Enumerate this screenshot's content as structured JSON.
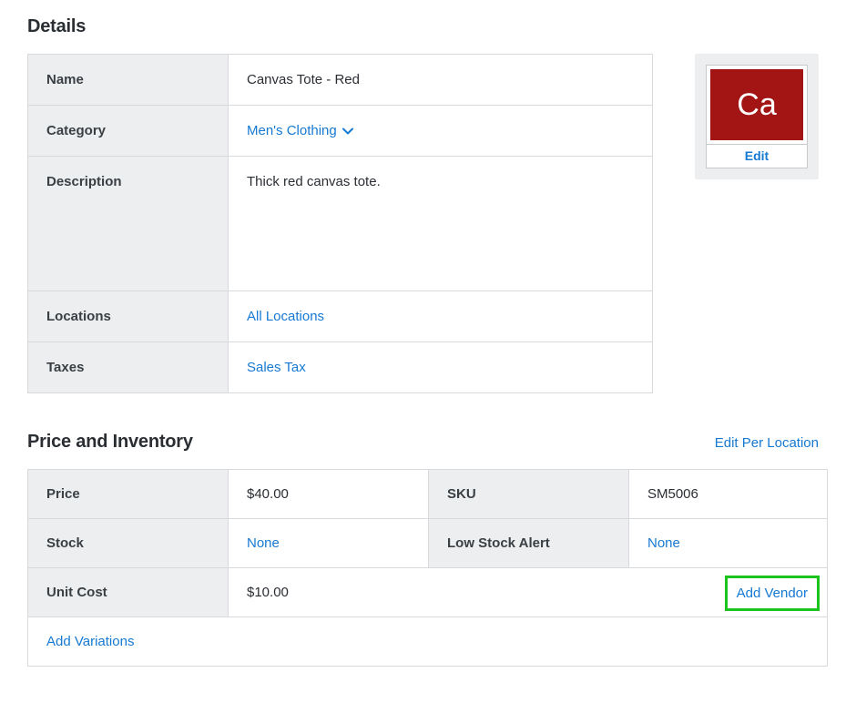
{
  "details": {
    "heading": "Details",
    "labels": {
      "name": "Name",
      "category": "Category",
      "description": "Description",
      "locations": "Locations",
      "taxes": "Taxes"
    },
    "name": "Canvas Tote - Red",
    "category": "Men's Clothing",
    "description": "Thick red canvas tote.",
    "locations": "All Locations",
    "taxes": "Sales Tax"
  },
  "thumbnail": {
    "swatch_text": "Ca",
    "swatch_color": "#a31515",
    "edit_label": "Edit"
  },
  "inventory": {
    "heading": "Price and Inventory",
    "edit_per_location_label": "Edit Per Location",
    "labels": {
      "price": "Price",
      "sku": "SKU",
      "stock": "Stock",
      "low_stock_alert": "Low Stock Alert",
      "unit_cost": "Unit Cost"
    },
    "price": "$40.00",
    "sku": "SM5006",
    "stock": "None",
    "low_stock_alert": "None",
    "unit_cost": "$10.00",
    "add_vendor_label": "Add Vendor",
    "add_variations_label": "Add Variations"
  }
}
